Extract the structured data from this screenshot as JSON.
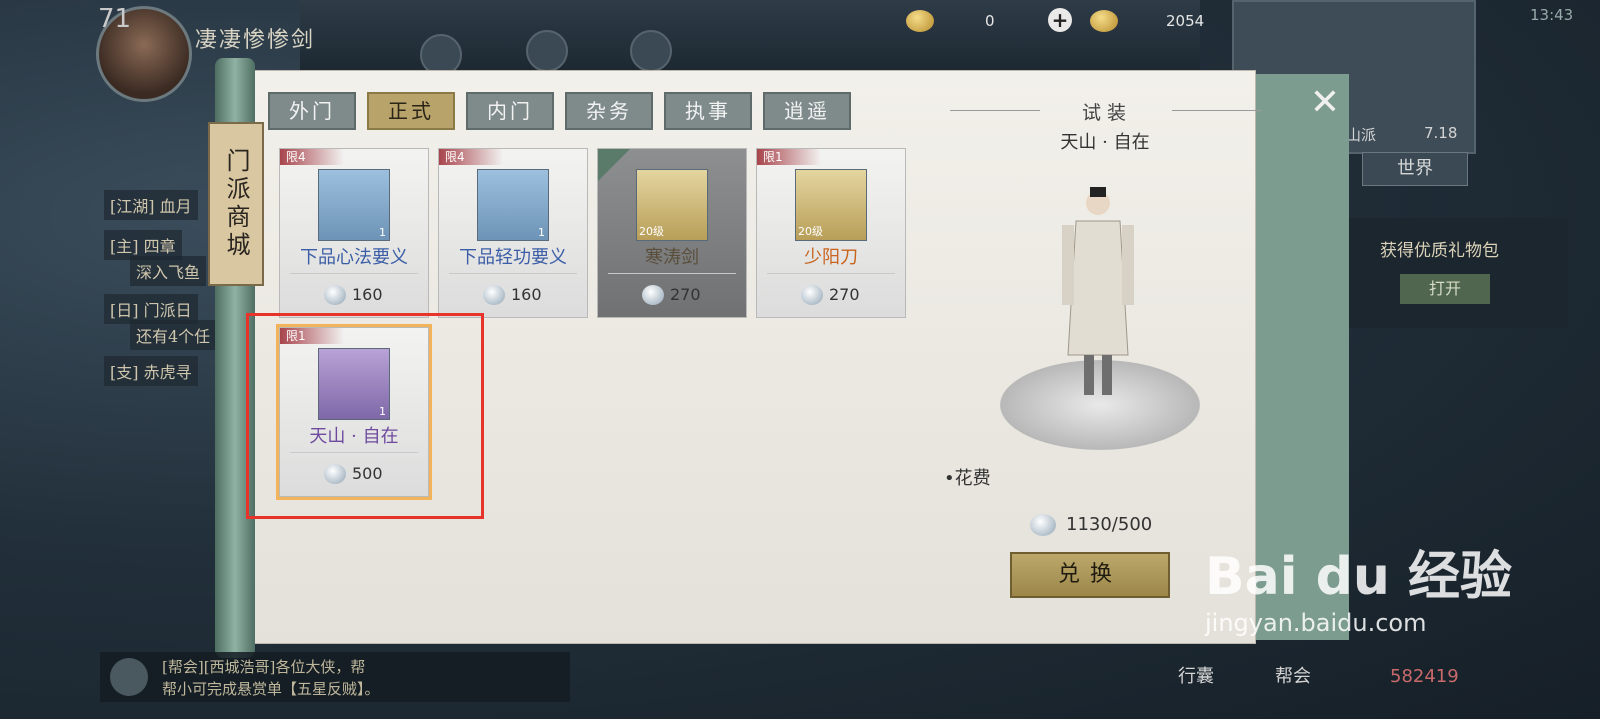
{
  "hud": {
    "level": "71",
    "player_name": "凄凄惨惨剑",
    "resources": [
      {
        "icon": "gold-ingot-icon",
        "value": "0"
      },
      {
        "icon": "gold-coin-icon",
        "value": "2054"
      },
      {
        "icon": "silver-token-icon",
        "value": "1130"
      }
    ],
    "time": "13:43",
    "world_button": "世界",
    "map_label": "山派",
    "map_coord": "7.18",
    "gift_text": "获得优质礼物包",
    "gift_button": "打开",
    "quests": [
      "[江湖] 血月",
      "[主] 四章",
      "深入飞鱼",
      "[日] 门派日",
      "还有4个任",
      "[支] 赤虎寻"
    ]
  },
  "shop": {
    "title": "门派商城",
    "tabs": [
      "外门",
      "正式",
      "内门",
      "杂务",
      "执事",
      "逍遥"
    ],
    "active_tab": 1,
    "items": [
      {
        "limit": "限4",
        "name": "下品心法要义",
        "price": "160",
        "qty": "1",
        "color": "#3b5ea6"
      },
      {
        "limit": "限4",
        "name": "下品轻功要义",
        "price": "160",
        "qty": "1",
        "color": "#3b5ea6"
      },
      {
        "limit": "",
        "name": "寒涛剑",
        "price": "270",
        "level": "20级",
        "locked": true
      },
      {
        "limit": "限1",
        "name": "少阳刀",
        "price": "270",
        "level": "20级",
        "color": "#c8641e"
      },
      {
        "limit": "限1",
        "name": "天山 · 自在",
        "price": "500",
        "qty": "1",
        "color": "#6e4a9e",
        "selected": true
      }
    ],
    "preview": {
      "title": "试装",
      "item_name": "天山 · 自在",
      "cost_label": "•花费",
      "cost_value": "1130/500",
      "exchange_button": "兑换"
    }
  },
  "chat": {
    "line1": "[帮会][西城浩哥]各位大侠，帮",
    "line2": "帮小可完成悬赏单【五星反贼】。"
  },
  "bottom_right": {
    "label1": "行囊",
    "label2": "帮会",
    "number": "582419"
  },
  "watermark": {
    "brand": "Bai du 经验",
    "url": "jingyan.baidu.com"
  }
}
